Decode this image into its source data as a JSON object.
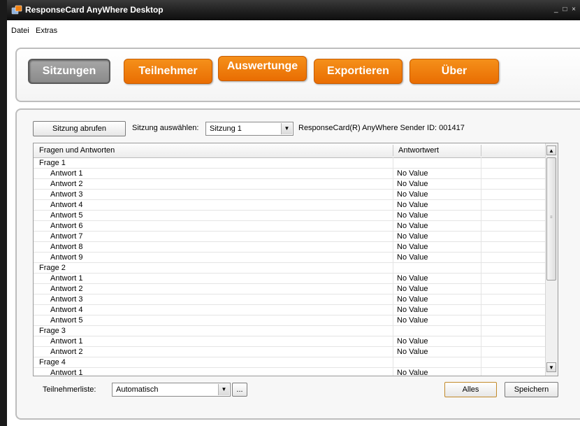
{
  "window": {
    "title": "ResponseCard AnyWhere Desktop",
    "controls": "_ □ ×"
  },
  "menu": {
    "items": [
      "Datei",
      "Extras"
    ]
  },
  "nav": {
    "tabs": [
      "Sitzungen",
      "Teilnehmer",
      "Auswertunge",
      "Exportieren",
      "Über"
    ],
    "active": "Sitzungen"
  },
  "toolbar": {
    "fetch_button": "Sitzung abrufen",
    "select_label": "Sitzung auswählen:",
    "select_value": "Sitzung 1",
    "sender_text": "ResponseCard(R) AnyWhere Sender ID: 001417"
  },
  "table": {
    "columns": [
      "Fragen und Antworten",
      "Antwortwert",
      ""
    ],
    "rows": [
      {
        "label": "Frage 1",
        "value": "",
        "type": "question"
      },
      {
        "label": "Antwort 1",
        "value": "No Value",
        "type": "answer"
      },
      {
        "label": "Antwort 2",
        "value": "No Value",
        "type": "answer"
      },
      {
        "label": "Antwort 3",
        "value": "No Value",
        "type": "answer"
      },
      {
        "label": "Antwort 4",
        "value": "No Value",
        "type": "answer"
      },
      {
        "label": "Antwort 5",
        "value": "No Value",
        "type": "answer"
      },
      {
        "label": "Antwort 6",
        "value": "No Value",
        "type": "answer"
      },
      {
        "label": "Antwort 7",
        "value": "No Value",
        "type": "answer"
      },
      {
        "label": "Antwort 8",
        "value": "No Value",
        "type": "answer"
      },
      {
        "label": "Antwort 9",
        "value": "No Value",
        "type": "answer"
      },
      {
        "label": "Frage 2",
        "value": "",
        "type": "question"
      },
      {
        "label": "Antwort 1",
        "value": "No Value",
        "type": "answer"
      },
      {
        "label": "Antwort 2",
        "value": "No Value",
        "type": "answer"
      },
      {
        "label": "Antwort 3",
        "value": "No Value",
        "type": "answer"
      },
      {
        "label": "Antwort 4",
        "value": "No Value",
        "type": "answer"
      },
      {
        "label": "Antwort 5",
        "value": "No Value",
        "type": "answer"
      },
      {
        "label": "Frage 3",
        "value": "",
        "type": "question"
      },
      {
        "label": "Antwort 1",
        "value": "No Value",
        "type": "answer"
      },
      {
        "label": "Antwort 2",
        "value": "No Value",
        "type": "answer"
      },
      {
        "label": "Frage 4",
        "value": "",
        "type": "question"
      },
      {
        "label": "Antwort 1",
        "value": "No Value",
        "type": "answer"
      }
    ]
  },
  "footer": {
    "participants_label": "Teilnehmerliste:",
    "participants_value": "Automatisch",
    "browse_button": "...",
    "all_button": "Alles",
    "save_button": "Speichern"
  },
  "colors": {
    "accent": "#f08010",
    "active_tab": "#999999",
    "titlebar": "#1e1e1e"
  }
}
